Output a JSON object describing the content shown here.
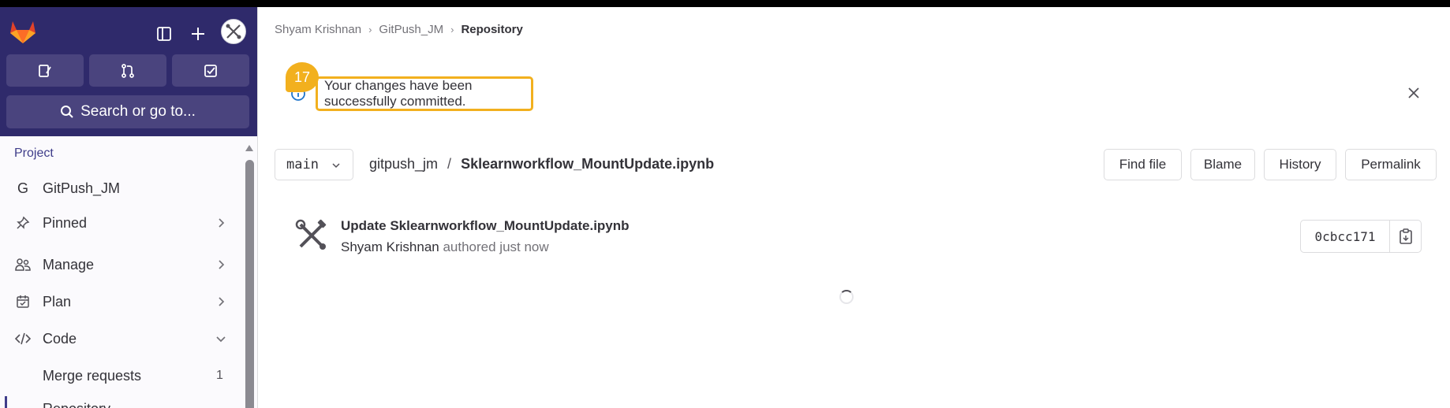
{
  "sidebar": {
    "search_label": "Search or go to...",
    "section_title": "Project",
    "items": [
      {
        "label": "GitPush_JM",
        "icon": "project-initial-g"
      },
      {
        "label": "Pinned",
        "icon": "pin-icon"
      },
      {
        "label": "Manage",
        "icon": "users-icon"
      },
      {
        "label": "Plan",
        "icon": "calendar-icon"
      },
      {
        "label": "Code",
        "icon": "code-icon"
      },
      {
        "label": "Merge requests",
        "count": "1"
      },
      {
        "label": "Repository"
      }
    ],
    "project_initial": "G"
  },
  "breadcrumb": {
    "items": [
      "Shyam Krishnan",
      "GitPush_JM",
      "Repository"
    ]
  },
  "alert": {
    "message": "Your changes have been successfully committed.",
    "step_number": "17"
  },
  "repo": {
    "branch": "main",
    "root": "gitpush_jm",
    "separator": "/",
    "file": "Sklearnworkflow_MountUpdate.ipynb",
    "actions": [
      "Find file",
      "Blame",
      "History",
      "Permalink"
    ]
  },
  "commit": {
    "title": "Update Sklearnworkflow_MountUpdate.ipynb",
    "author": "Shyam Krishnan",
    "meta": "authored just now",
    "sha": "0cbcc171"
  },
  "colors": {
    "sidebar_header": "#2f2a6b",
    "sidebar_button": "#4a447e",
    "highlight": "#f2b01e",
    "info": "#1f75cb"
  }
}
